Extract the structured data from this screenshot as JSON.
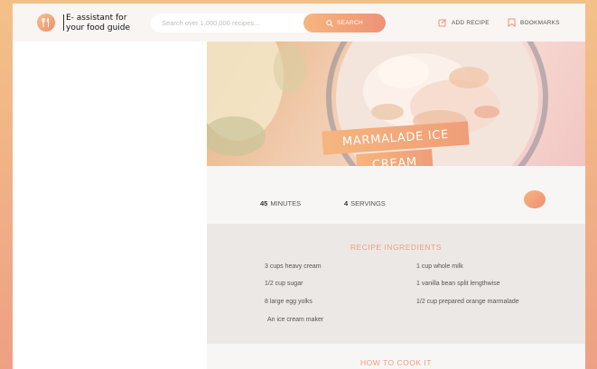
{
  "header": {
    "brand": "E- assistant for your food guide",
    "search_placeholder": "Search over 1,000,000 recipes...",
    "search_button": "SEARCH",
    "add_recipe": "ADD RECIPE",
    "bookmarks": "BOOKMARKS"
  },
  "recipe": {
    "title_line1": "MARMALADE ICE",
    "title_line2": "CREAM",
    "minutes_value": "45",
    "minutes_label": "MINUTES",
    "servings_value": "4",
    "servings_label": "SERVINGS",
    "ingredients_title": "RECIPE INGREDIENTS",
    "ingredients": [
      "3 cups heavy cream",
      "1 cup whole milk",
      "1/2 cup sugar",
      "1 vanilla bean split lengthwise",
      "8 large egg yolks",
      "1/2 cup prepared orange marmalade",
      "An ice cream maker"
    ],
    "cook_title": "HOW TO COOK IT"
  },
  "colors": {
    "accent_start": "#f6b57e",
    "accent_end": "#ef9277",
    "section_title": "#ef9d7f"
  },
  "icons": [
    "utensils-icon",
    "search-icon",
    "edit-icon",
    "bookmark-icon",
    "heart-icon"
  ]
}
